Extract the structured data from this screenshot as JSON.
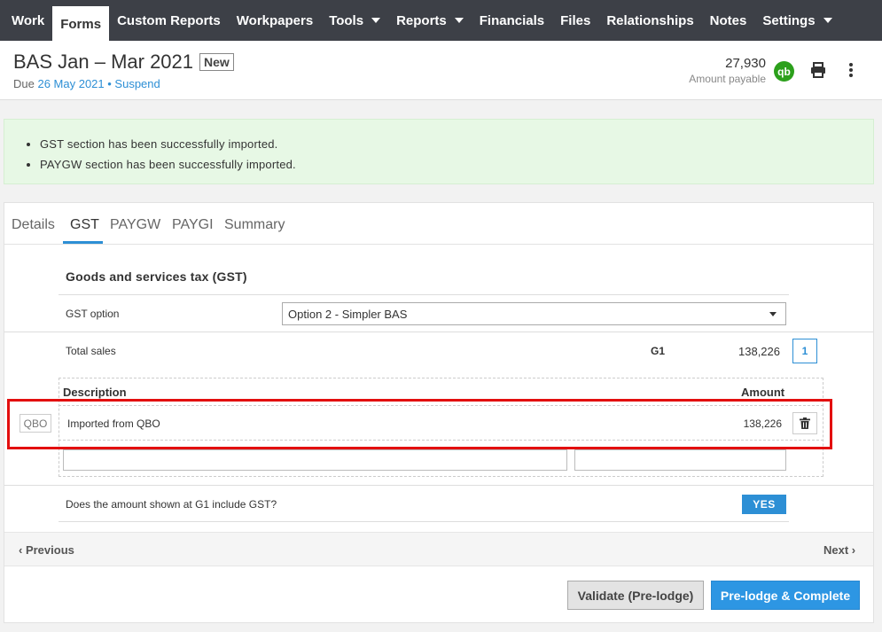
{
  "nav": {
    "items": [
      {
        "label": "Work",
        "active": false,
        "dropdown": false
      },
      {
        "label": "Forms",
        "active": true,
        "dropdown": false
      },
      {
        "label": "Custom Reports",
        "active": false,
        "dropdown": false
      },
      {
        "label": "Workpapers",
        "active": false,
        "dropdown": false
      },
      {
        "label": "Tools",
        "active": false,
        "dropdown": true
      },
      {
        "label": "Reports",
        "active": false,
        "dropdown": true
      },
      {
        "label": "Financials",
        "active": false,
        "dropdown": false
      },
      {
        "label": "Files",
        "active": false,
        "dropdown": false
      },
      {
        "label": "Relationships",
        "active": false,
        "dropdown": false
      },
      {
        "label": "Notes",
        "active": false,
        "dropdown": false
      },
      {
        "label": "Settings",
        "active": false,
        "dropdown": true
      }
    ]
  },
  "header": {
    "title": "BAS Jan – Mar 2021",
    "badge": "New",
    "due_prefix": "Due ",
    "due_date": "26 May 2021",
    "separator": " • ",
    "suspend": "Suspend",
    "amount_value": "27,930",
    "amount_label": "Amount payable",
    "qb_label": "qb"
  },
  "alerts": [
    "GST section has been successfully imported.",
    "PAYGW section has been successfully imported."
  ],
  "tabs": [
    {
      "label": "Details",
      "active": false
    },
    {
      "label": "GST",
      "active": true
    },
    {
      "label": "PAYGW",
      "active": false
    },
    {
      "label": "PAYGI",
      "active": false
    },
    {
      "label": "Summary",
      "active": false
    }
  ],
  "gst": {
    "section_title": "Goods and services tax (GST)",
    "option_label": "GST option",
    "option_value": "Option 2 - Simpler BAS",
    "total_sales_label": "Total sales",
    "g1_code": "G1",
    "g1_amount": "138,226",
    "entries_count": "1",
    "col_description": "Description",
    "col_amount": "Amount",
    "source_tag": "QBO",
    "import_description": "Imported from QBO",
    "import_amount": "138,226",
    "question": "Does the amount shown at G1 include GST?",
    "answer": "YES"
  },
  "pager": {
    "previous": "Previous",
    "next": "Next"
  },
  "actions": {
    "validate": "Validate (Pre-lodge)",
    "prelodge": "Pre-lodge & Complete"
  }
}
